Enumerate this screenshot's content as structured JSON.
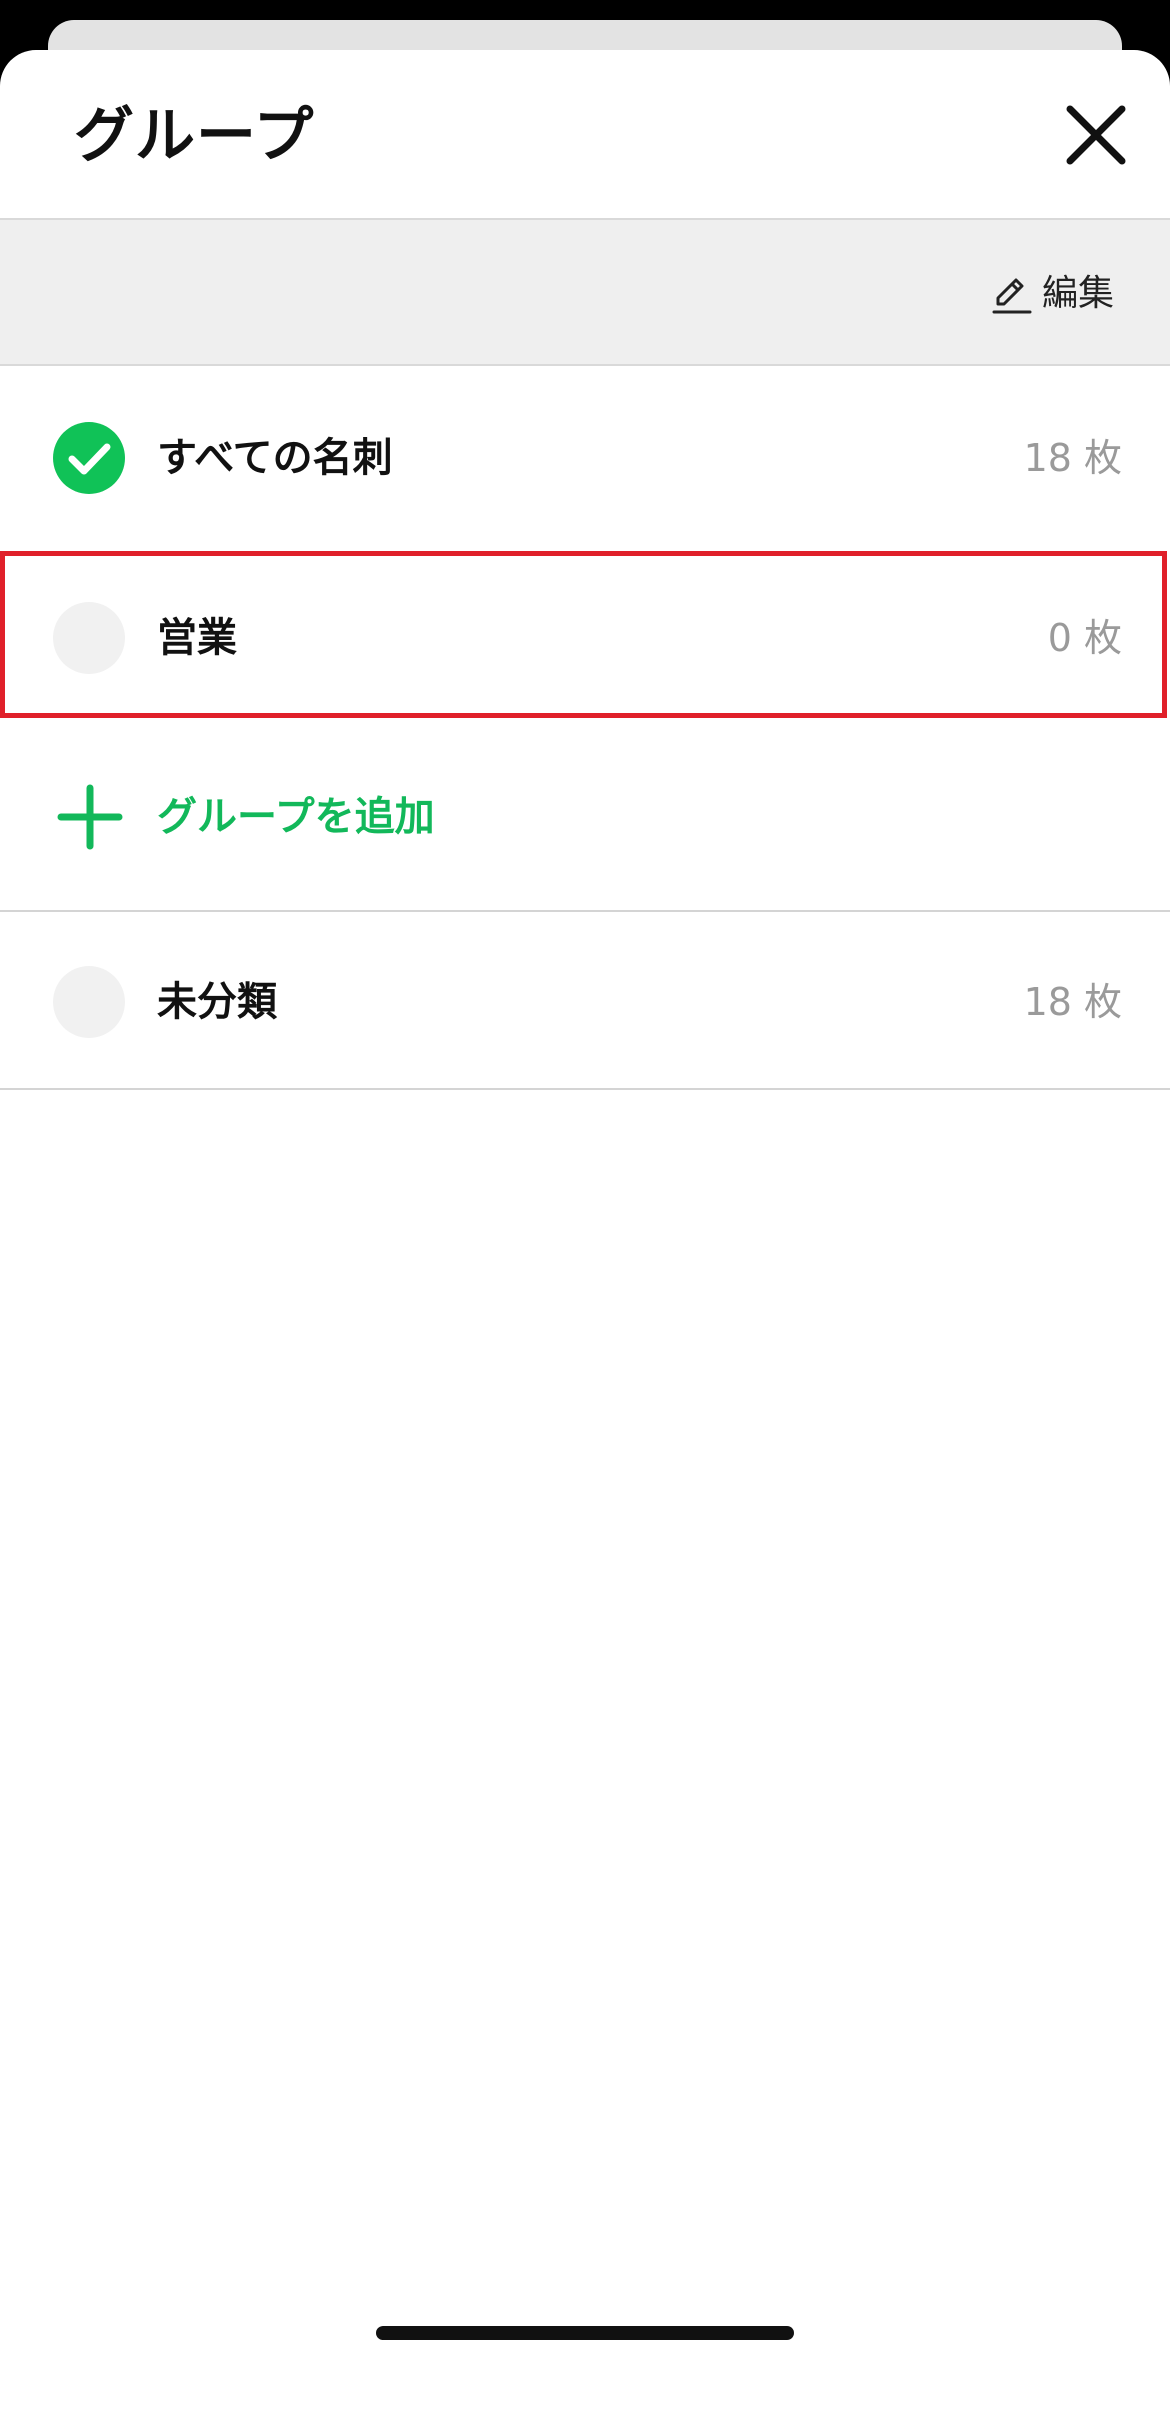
{
  "header": {
    "title": "グループ",
    "close_icon": "close-icon"
  },
  "toolbar": {
    "edit_label": "編集",
    "edit_icon": "pencil-icon"
  },
  "groups": [
    {
      "label": "すべての名刺",
      "count": "18 枚",
      "selected": true
    },
    {
      "label": "営業",
      "count": "0 枚",
      "selected": false
    },
    {
      "label": "未分類",
      "count": "18 枚",
      "selected": false
    }
  ],
  "add_group": {
    "label": "グループを追加",
    "icon": "plus-icon"
  },
  "colors": {
    "accent": "#10c257",
    "highlight": "#e0202a",
    "count_text": "#9a9a9a"
  }
}
